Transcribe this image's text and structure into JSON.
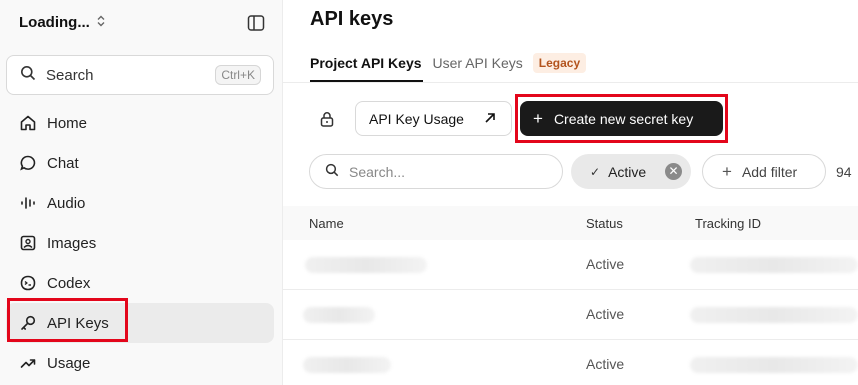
{
  "sidebar": {
    "org_name": "Loading...",
    "search": {
      "label": "Search",
      "shortcut": "Ctrl+K"
    },
    "items": [
      {
        "label": "Home",
        "icon": "home-icon"
      },
      {
        "label": "Chat",
        "icon": "chat-icon"
      },
      {
        "label": "Audio",
        "icon": "audio-icon"
      },
      {
        "label": "Images",
        "icon": "image-icon"
      },
      {
        "label": "Codex",
        "icon": "codex-icon"
      },
      {
        "label": "API Keys",
        "icon": "key-icon",
        "active": true
      },
      {
        "label": "Usage",
        "icon": "trend-icon"
      }
    ]
  },
  "main": {
    "title": "API keys",
    "tabs": [
      {
        "label": "Project API Keys",
        "active": true
      },
      {
        "label": "User API Keys"
      }
    ],
    "legacy_badge": "Legacy",
    "usage_button": "API Key Usage",
    "create_button": "Create new secret key",
    "filter": {
      "search_placeholder": "Search...",
      "active_chip": "Active",
      "add_filter": "Add filter",
      "count": "94"
    },
    "table": {
      "headers": [
        "Name",
        "Status",
        "Tracking ID"
      ],
      "rows": [
        {
          "status": "Active"
        },
        {
          "status": "Active"
        },
        {
          "status": "Active"
        }
      ]
    }
  },
  "colors": {
    "highlight": "#e3061b",
    "primary_button": "#1a1a1a",
    "legacy_badge_bg": "#fdeee3"
  }
}
